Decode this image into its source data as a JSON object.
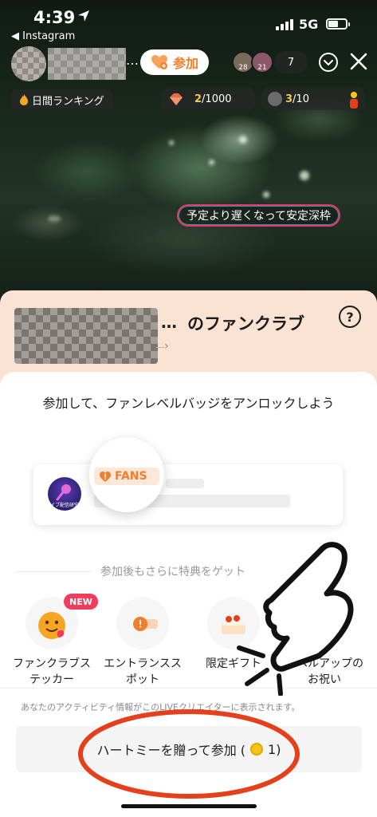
{
  "status_bar": {
    "time": "4:39",
    "back_app": "◀ Instagram",
    "network": "5G"
  },
  "live_header": {
    "join_label": "参加",
    "viewer_count": "7",
    "viewer_badges": [
      "28",
      "21"
    ],
    "daily_ranking": "日間ランキング",
    "goal_gift": {
      "current": "2",
      "total": "/1000"
    },
    "goal_members": {
      "current": "3",
      "total": "/10"
    },
    "comment": "予定より遅くなって安定深枠"
  },
  "fan_club": {
    "ellipsis": "…",
    "title": "のファンクラブ",
    "help": "?",
    "chevron": "›",
    "unlock_text": "参加して、ファンレベルバッジをアンロックしよう",
    "fans_badge": "FANS",
    "preview_avatar_text": "ライブ配信研究所",
    "benefits_title": "参加後もさらに特典をゲット",
    "benefits": [
      {
        "label": "ファンクラブステッカー",
        "badge": "NEW"
      },
      {
        "label": "エントランススポット"
      },
      {
        "label": "限定ギフト"
      },
      {
        "label": "レベルアップのお祝い"
      }
    ],
    "activity_note": "あなたのアクティビティ情報がこのLIVEクリエイターに表示されます。",
    "cta": {
      "label": "ハートミーを贈って参加 (",
      "coins": "1)"
    }
  },
  "colors": {
    "accent": "#f27d2c",
    "sheet_bg": "#fbe3d3",
    "new_badge": "#f23c5e",
    "annotation": "#e3401b"
  }
}
